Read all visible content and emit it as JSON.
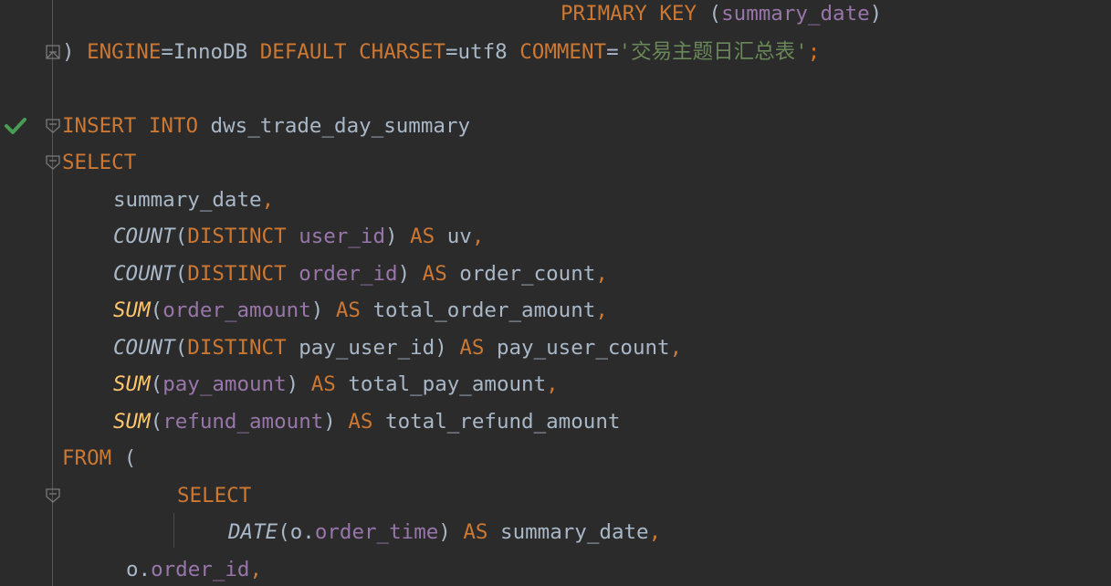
{
  "editor": {
    "lines": [
      {
        "id": "l1",
        "segments": [
          {
            "t": "PRIMARY KEY",
            "c": "kw"
          },
          {
            "t": " (",
            "c": "pl"
          },
          {
            "t": "summary_date",
            "c": "col"
          },
          {
            "t": ")",
            "c": "pl"
          }
        ]
      },
      {
        "id": "l2",
        "segments": [
          {
            "t": ") ",
            "c": "pl"
          },
          {
            "t": "ENGINE",
            "c": "kw"
          },
          {
            "t": "=InnoDB ",
            "c": "pl"
          },
          {
            "t": "DEFAULT CHARSET",
            "c": "kw"
          },
          {
            "t": "=utf8 ",
            "c": "pl"
          },
          {
            "t": "COMMENT",
            "c": "kw"
          },
          {
            "t": "=",
            "c": "pl"
          },
          {
            "t": "'交易主题日汇总表'",
            "c": "str"
          },
          {
            "t": ";",
            "c": "kw"
          }
        ]
      },
      {
        "id": "l3",
        "segments": []
      },
      {
        "id": "l4",
        "segments": [
          {
            "t": "INSERT INTO",
            "c": "kw"
          },
          {
            "t": " dws_trade_day_summary",
            "c": "pl"
          }
        ]
      },
      {
        "id": "l5",
        "segments": [
          {
            "t": "SELECT",
            "c": "kw"
          }
        ]
      },
      {
        "id": "l6",
        "segments": [
          {
            "t": "summary_date",
            "c": "pl"
          },
          {
            "t": ",",
            "c": "kw"
          }
        ]
      },
      {
        "id": "l7",
        "segments": [
          {
            "t": "COUNT",
            "c": "fn"
          },
          {
            "t": "(",
            "c": "pl"
          },
          {
            "t": "DISTINCT",
            "c": "kw"
          },
          {
            "t": " ",
            "c": "pl"
          },
          {
            "t": "user_id",
            "c": "col"
          },
          {
            "t": ") ",
            "c": "pl"
          },
          {
            "t": "AS",
            "c": "kw"
          },
          {
            "t": " uv",
            "c": "pl"
          },
          {
            "t": ",",
            "c": "kw"
          }
        ]
      },
      {
        "id": "l8",
        "segments": [
          {
            "t": "COUNT",
            "c": "fn"
          },
          {
            "t": "(",
            "c": "pl"
          },
          {
            "t": "DISTINCT",
            "c": "kw"
          },
          {
            "t": " ",
            "c": "pl"
          },
          {
            "t": "order_id",
            "c": "col"
          },
          {
            "t": ") ",
            "c": "pl"
          },
          {
            "t": "AS",
            "c": "kw"
          },
          {
            "t": " order_count",
            "c": "pl"
          },
          {
            "t": ",",
            "c": "kw"
          }
        ]
      },
      {
        "id": "l9",
        "segments": [
          {
            "t": "SUM",
            "c": "fn-sum"
          },
          {
            "t": "(",
            "c": "pl"
          },
          {
            "t": "order_amount",
            "c": "col"
          },
          {
            "t": ") ",
            "c": "pl"
          },
          {
            "t": "AS",
            "c": "kw"
          },
          {
            "t": " total_order_amount",
            "c": "pl"
          },
          {
            "t": ",",
            "c": "kw"
          }
        ]
      },
      {
        "id": "l10",
        "segments": [
          {
            "t": "COUNT",
            "c": "fn"
          },
          {
            "t": "(",
            "c": "pl"
          },
          {
            "t": "DISTINCT",
            "c": "kw"
          },
          {
            "t": " pay_user_id) ",
            "c": "pl"
          },
          {
            "t": "AS",
            "c": "kw"
          },
          {
            "t": " pay_user_count",
            "c": "pl"
          },
          {
            "t": ",",
            "c": "kw"
          }
        ]
      },
      {
        "id": "l11",
        "segments": [
          {
            "t": "SUM",
            "c": "fn-sum"
          },
          {
            "t": "(",
            "c": "pl"
          },
          {
            "t": "pay_amount",
            "c": "col"
          },
          {
            "t": ") ",
            "c": "pl"
          },
          {
            "t": "AS",
            "c": "kw"
          },
          {
            "t": " total_pay_amount",
            "c": "pl"
          },
          {
            "t": ",",
            "c": "kw"
          }
        ]
      },
      {
        "id": "l12",
        "segments": [
          {
            "t": "SUM",
            "c": "fn-sum"
          },
          {
            "t": "(",
            "c": "pl"
          },
          {
            "t": "refund_amount",
            "c": "col"
          },
          {
            "t": ") ",
            "c": "pl"
          },
          {
            "t": "AS",
            "c": "kw"
          },
          {
            "t": " total_refund_amount",
            "c": "pl"
          }
        ]
      },
      {
        "id": "l13",
        "segments": [
          {
            "t": "FROM",
            "c": "kw"
          },
          {
            "t": " (",
            "c": "pl"
          }
        ]
      },
      {
        "id": "l14",
        "segments": [
          {
            "t": "SELECT",
            "c": "kw"
          }
        ]
      },
      {
        "id": "l15",
        "segments": [
          {
            "t": "DATE",
            "c": "fn"
          },
          {
            "t": "(o.",
            "c": "pl"
          },
          {
            "t": "order_time",
            "c": "col"
          },
          {
            "t": ") ",
            "c": "pl"
          },
          {
            "t": "AS",
            "c": "kw"
          },
          {
            "t": " summary_date",
            "c": "pl"
          },
          {
            "t": ",",
            "c": "kw"
          }
        ]
      },
      {
        "id": "l16",
        "segments": [
          {
            "t": "o.",
            "c": "pl"
          },
          {
            "t": "order_id",
            "c": "col"
          },
          {
            "t": ",",
            "c": "kw"
          }
        ]
      }
    ]
  },
  "colors": {
    "background": "#2b2b2b",
    "keyword": "#cc7832",
    "column": "#9876aa",
    "string": "#6a8759",
    "function_sum": "#ffc66d",
    "plain": "#a9b7c6",
    "check": "#499c54"
  },
  "icons": {
    "fold_markers": [
      "fold-end-icon",
      "fold-start-icon",
      "fold-start-icon",
      "fold-start-icon"
    ],
    "run_status": "check-icon"
  }
}
